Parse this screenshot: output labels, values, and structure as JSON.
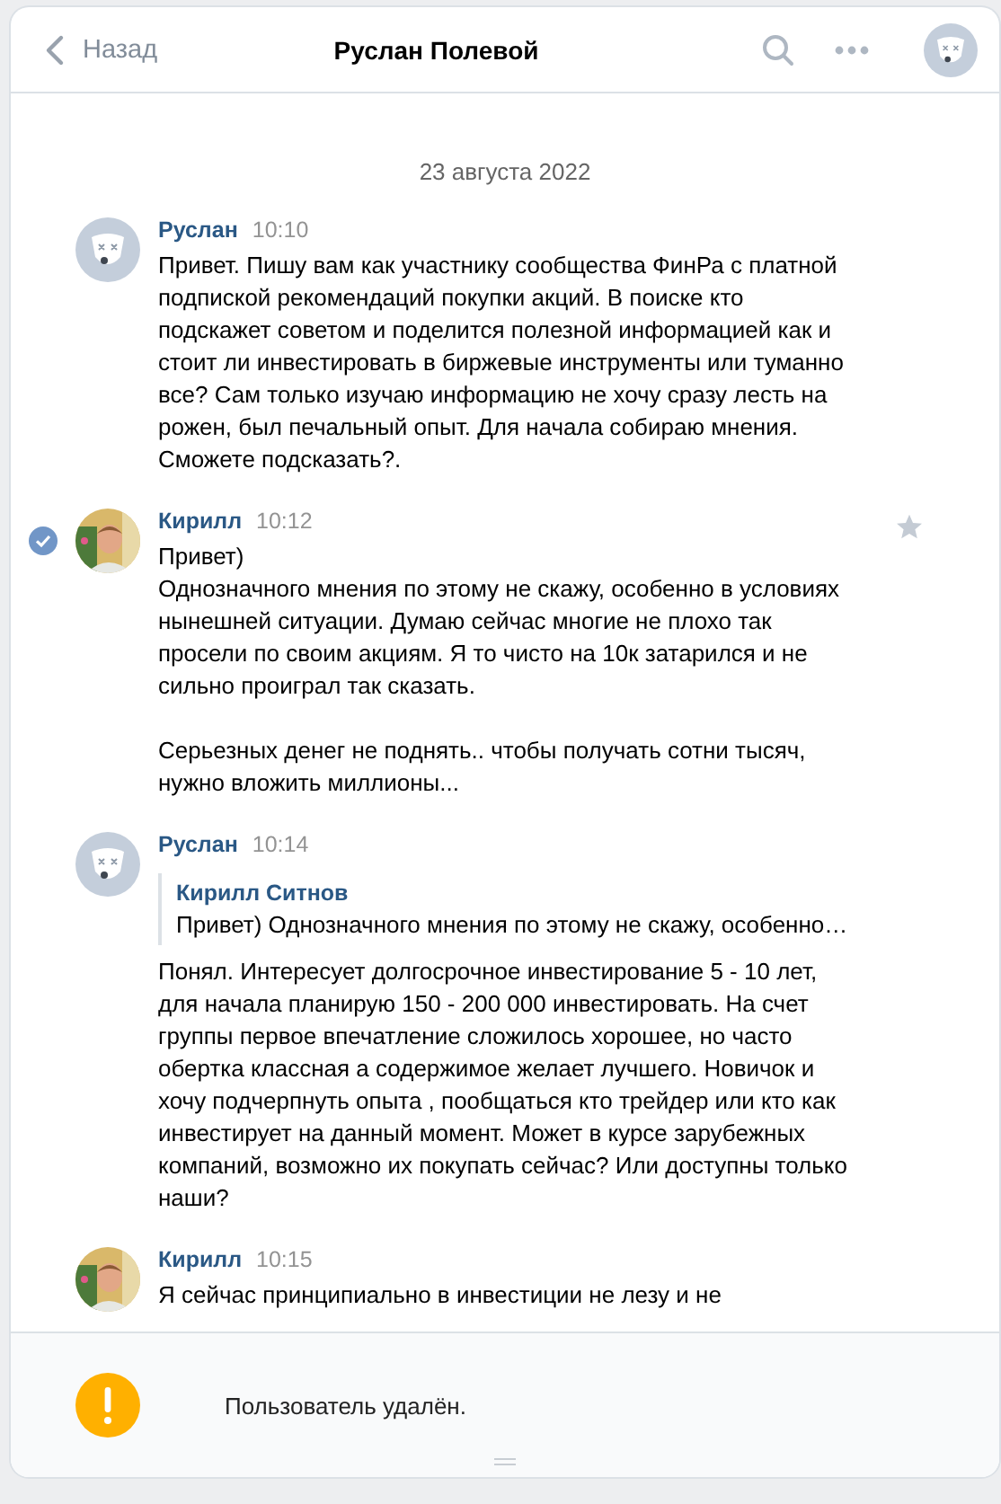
{
  "header": {
    "back_label": "Назад",
    "title": "Руслан Полевой",
    "avatar": {
      "kind": "default"
    }
  },
  "date": "23 августа 2022",
  "messages": [
    {
      "author": "Руслан",
      "time": "10:10",
      "avatar": {
        "kind": "default"
      },
      "selected": false,
      "text": "Привет. Пишу вам как участнику сообщества ФинРа с платной подпиской рекомендаций покупки акций. В поиске кто подскажет советом и поделится полезной информацией как и стоит ли инвестировать в биржевые инструменты или туманно все? Сам только изучаю информацию не хочу сразу лесть на рожен, был печальный опыт. Для начала собираю мнения. Сможете подсказать?."
    },
    {
      "author": "Кирилл",
      "time": "10:12",
      "selected": true,
      "text": "Привет)\nОднозначного мнения по этому не скажу, особенно в условиях нынешней ситуации. Думаю сейчас многие не плохо так просели по своим акциям. Я то чисто на 10к затарился и не сильно проиграл так сказать.\n\nСерьезных денег не поднять.. чтобы получать сотни тысяч, нужно вложить миллионы..."
    },
    {
      "author": "Руслан",
      "time": "10:14",
      "avatar": {
        "kind": "default"
      },
      "selected": false,
      "quote": {
        "author": "Кирилл Ситнов",
        "text": "Привет) Однозначного мнения по этому не скажу, особенно…"
      },
      "text": "Понял. Интересует долгосрочное инвестирование 5 - 10 лет, для начала планирую 150 - 200 000 инвестировать. На счет группы первое впечатление сложилось хорошее, но часто обертка классная а содержимое желает лучшего. Новичок и хочу подчерпнуть опыта , пообщаться кто трейдер или кто как инвестирует на данный момент. Может в курсе зарубежных компаний, возможно их покупать сейчас? Или доступны только наши?"
    },
    {
      "author": "Кирилл",
      "time": "10:15",
      "selected": false,
      "text": "Я сейчас принципиально в инвестиции не лезу и не"
    }
  ],
  "footer": {
    "notice": "Пользователь удалён."
  }
}
